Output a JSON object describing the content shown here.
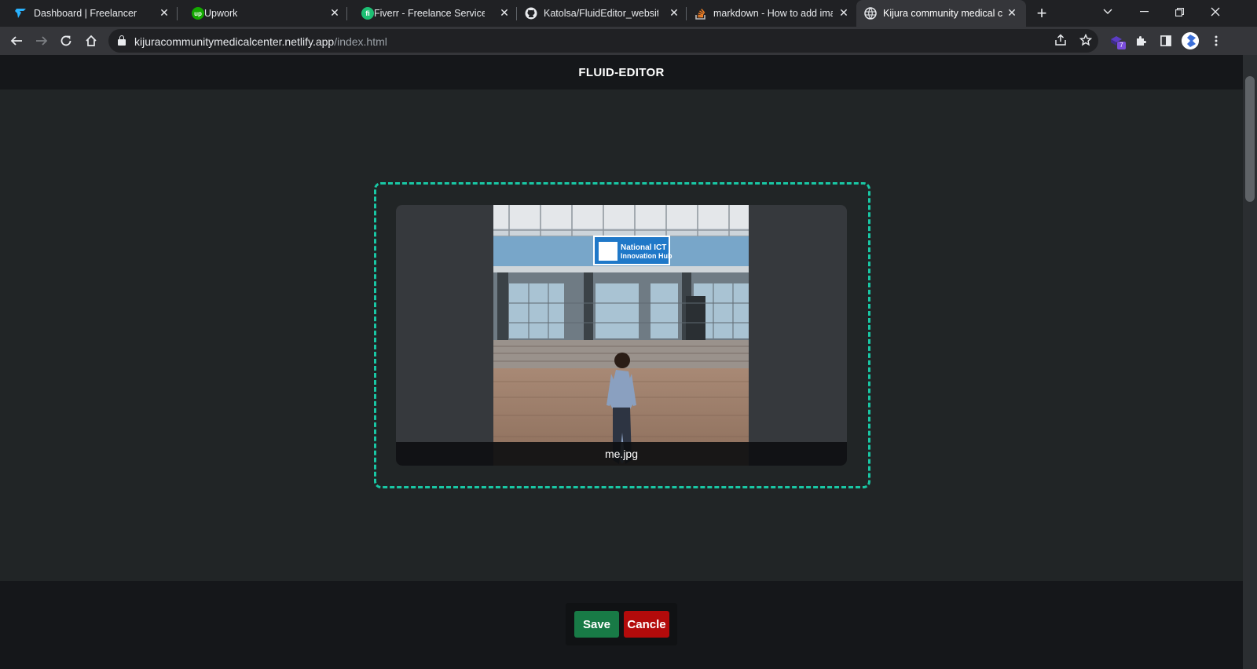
{
  "browser": {
    "tabs": [
      {
        "title": "Dashboard | Freelancer",
        "icon": "freelancer-icon",
        "active": false
      },
      {
        "title": "Upwork",
        "icon": "upwork-icon",
        "active": false
      },
      {
        "title": "Fiverr - Freelance Services Ma",
        "icon": "fiverr-icon",
        "active": false
      },
      {
        "title": "Katolsa/FluidEditor_website_e",
        "icon": "github-icon",
        "active": false
      },
      {
        "title": "markdown - How to add ima",
        "icon": "stackoverflow-icon",
        "active": false
      },
      {
        "title": "Kijura community medical cen",
        "icon": "globe-icon",
        "active": true
      }
    ],
    "fav_text": {
      "upwork": "up",
      "fiverr": "fi"
    },
    "new_tab_glyph": "+",
    "url_host": "kijuracommunitymedicalcenter.netlify.app",
    "url_path": "/index.html",
    "extension_badge": "7"
  },
  "app": {
    "title": "FLUID-EDITOR",
    "file_name": "me.jpg",
    "save_label": "Save",
    "cancel_label": "Cancle"
  },
  "photo_sign": {
    "line1": "National ICT",
    "line2": "Innovation Hub"
  },
  "colors": {
    "dropzone_border": "#19c7a4",
    "save": "#187a46",
    "cancel": "#b30b0b",
    "header_bg": "#15171a",
    "page_bg": "#212526"
  }
}
